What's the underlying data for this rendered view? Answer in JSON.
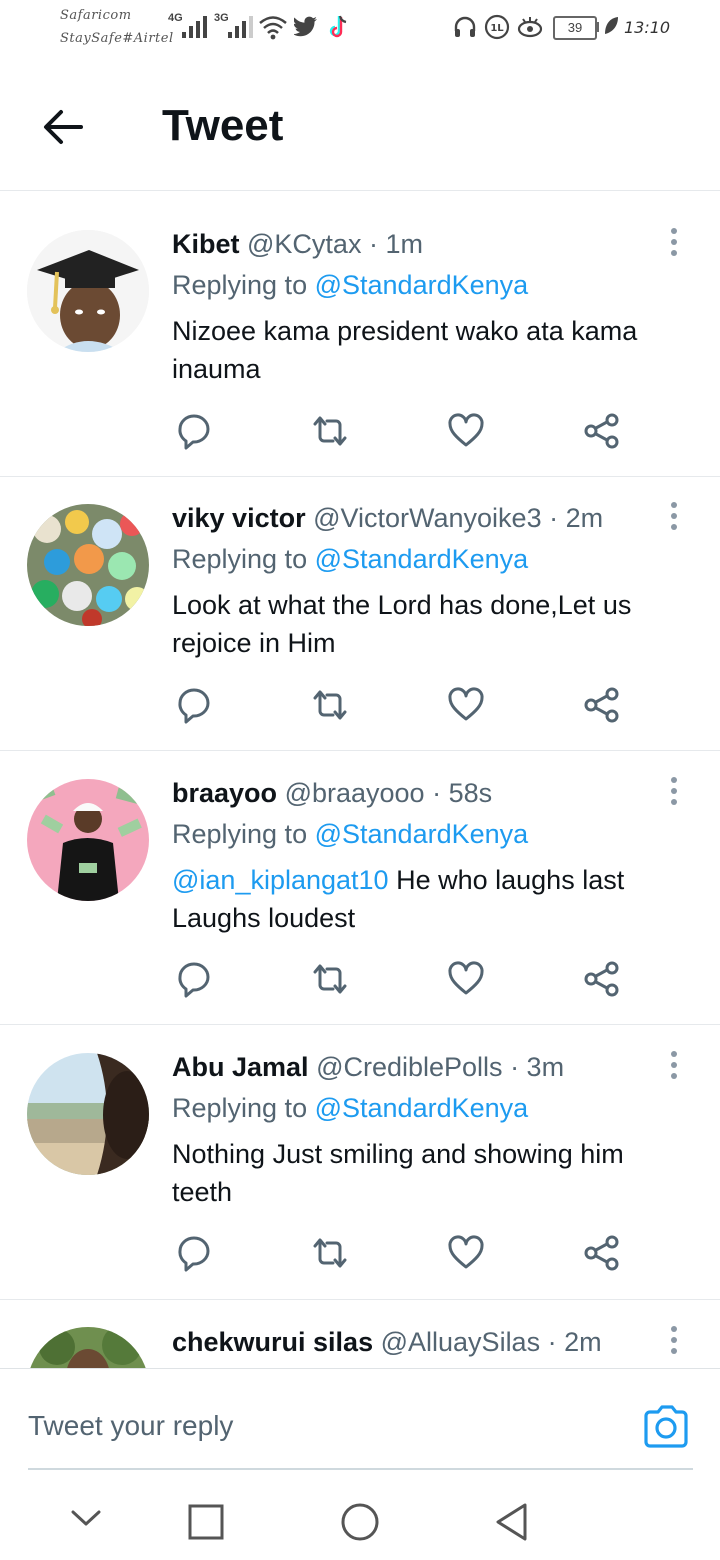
{
  "status_bar": {
    "carrier_1": "Safaricom",
    "carrier_2": "StaySafe#Airtel",
    "net_1": "4G",
    "net_2": "3G",
    "battery": "39",
    "time": "13:10"
  },
  "header": {
    "title": "Tweet",
    "back_icon": "arrow-left-icon"
  },
  "tweets": [
    {
      "name": "Kibet",
      "handle": "@KCytax",
      "time": "· 1m",
      "replying_prefix": "Replying to",
      "replying_to": "@StandardKenya",
      "mention": "",
      "text": "Nizoee kama president wako ata kama inauma"
    },
    {
      "name": "viky victor",
      "handle": "@VictorWanyoike3",
      "time": "· 2m",
      "replying_prefix": "Replying to",
      "replying_to": "@StandardKenya",
      "mention": "",
      "text": "Look at what the Lord has done,Let us rejoice in Him"
    },
    {
      "name": "braayoo",
      "handle": "@braayooo",
      "time": "· 58s",
      "replying_prefix": "Replying to",
      "replying_to": "@StandardKenya",
      "mention": "@ian_kiplangat10",
      "text": " He who laughs last Laughs loudest"
    },
    {
      "name": "Abu Jamal",
      "handle": "@CrediblePolls",
      "time": "· 3m",
      "replying_prefix": "Replying to",
      "replying_to": "@StandardKenya",
      "mention": "",
      "text": "Nothing Just smiling and showing him teeth"
    },
    {
      "name": "chekwurui silas",
      "handle": "@AlluaySilas",
      "time": "· 2m"
    }
  ],
  "action_icons": [
    "reply-icon",
    "retweet-icon",
    "like-icon",
    "share-icon"
  ],
  "reply_bar": {
    "placeholder": "Tweet your reply",
    "camera_icon": "camera-icon"
  },
  "nav_bar": {
    "icons": [
      "chevron-down-icon",
      "recents-square-icon",
      "home-circle-icon",
      "back-triangle-icon"
    ]
  },
  "colors": {
    "accent": "#1d9bf0",
    "text_primary": "#0f1419",
    "text_secondary": "#536471",
    "divider": "#e6e9ec"
  }
}
